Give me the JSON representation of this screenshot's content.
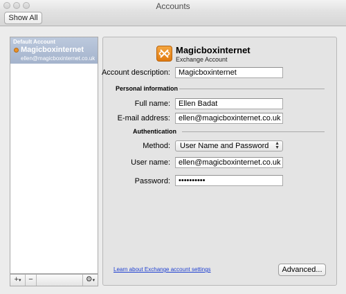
{
  "window": {
    "title": "Accounts"
  },
  "toolbar": {
    "show_all_label": "Show All"
  },
  "sidebar": {
    "section_label": "Default Account",
    "accounts": [
      {
        "name": "Magicboxinternet",
        "email": "ellen@magicboxinternet.co.uk"
      }
    ],
    "footer": {
      "add_label": "+",
      "add_arrow": "▾",
      "remove_label": "−",
      "gear_label": "⚙",
      "gear_arrow": "▾"
    }
  },
  "account": {
    "title": "Magicboxinternet",
    "subtitle": "Exchange Account",
    "description_label": "Account description:",
    "description_value": "Magicboxinternet",
    "personal_info_heading": "Personal information",
    "full_name_label": "Full name:",
    "full_name_value": "Ellen Badat",
    "email_label": "E-mail address:",
    "email_value": "ellen@magicboxinternet.co.uk",
    "auth_heading": "Authentication",
    "method_label": "Method:",
    "method_value": "User Name and Password",
    "username_label": "User name:",
    "username_value": "ellen@magicboxinternet.co.uk",
    "password_label": "Password:",
    "password_value": "••••••••••",
    "learn_link": "Learn about Exchange account settings",
    "advanced_label": "Advanced..."
  },
  "colors": {
    "selection": "#a4b3cc",
    "link": "#1e3fd0",
    "brand_orange": "#e07a10"
  }
}
